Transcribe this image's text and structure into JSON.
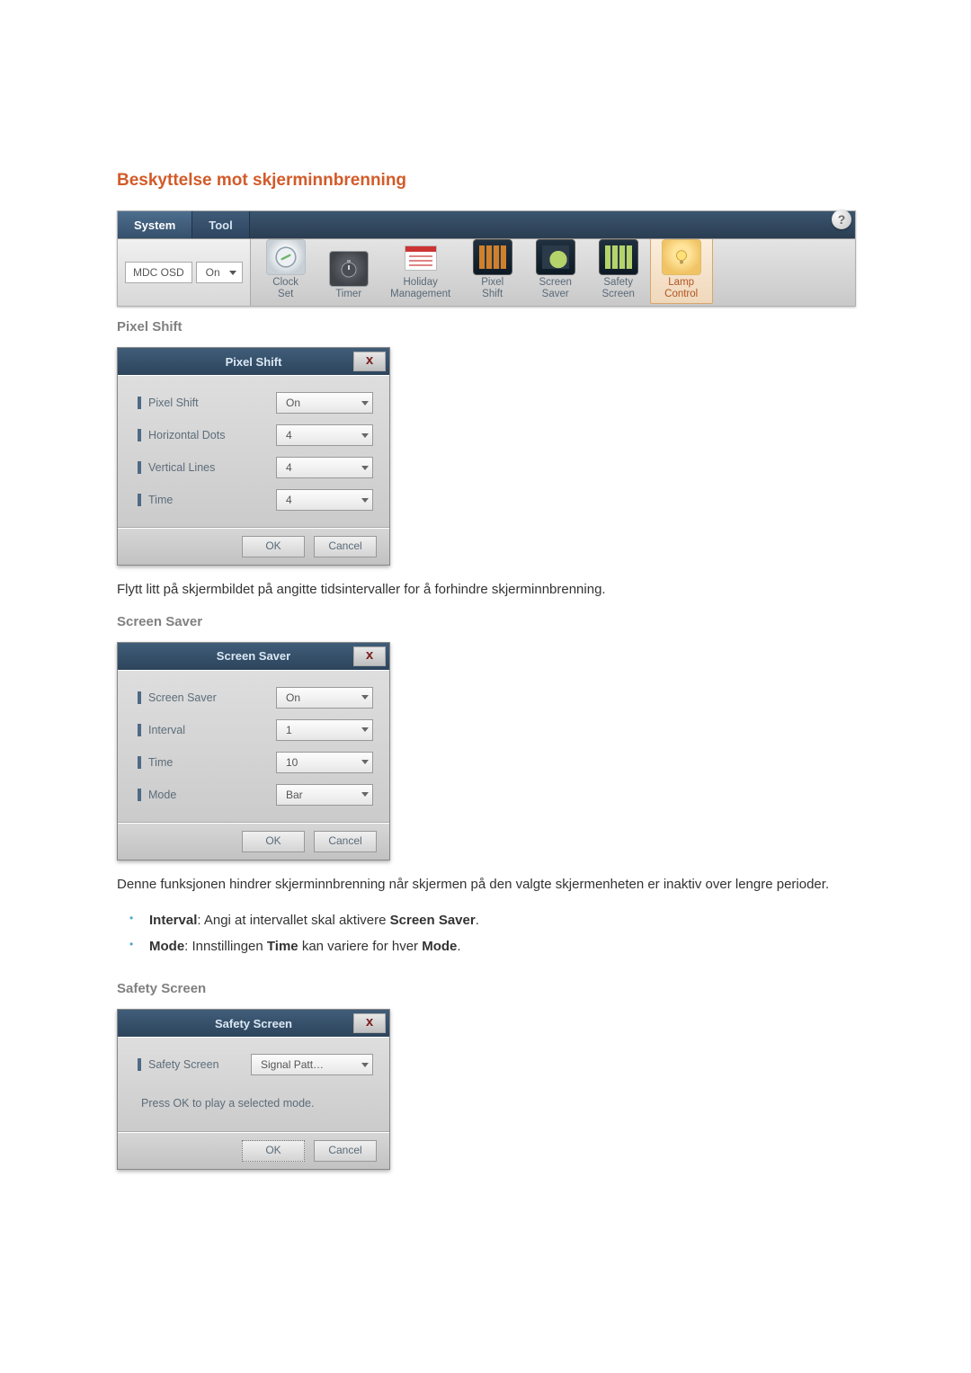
{
  "section_title": "Beskyttelse mot skjerminnbrenning",
  "toolbar": {
    "tabs": {
      "system": "System",
      "tool": "Tool"
    },
    "help": "?",
    "mdc_label": "MDC OSD",
    "mdc_value": "On",
    "buttons": {
      "clock_set": "Clock\nSet",
      "timer": "Timer",
      "holiday": "Holiday\nManagement",
      "pixel_shift": "Pixel\nShift",
      "screen_saver": "Screen\nSaver",
      "safety_screen": "Safety\nScreen",
      "lamp_control": "Lamp\nControl"
    }
  },
  "pixel_shift": {
    "heading": "Pixel Shift",
    "title": "Pixel Shift",
    "close": "x",
    "rows": {
      "pixel_shift": {
        "label": "Pixel Shift",
        "value": "On"
      },
      "horizontal": {
        "label": "Horizontal Dots",
        "value": "4"
      },
      "vertical": {
        "label": "Vertical Lines",
        "value": "4"
      },
      "time": {
        "label": "Time",
        "value": "4"
      }
    },
    "ok": "OK",
    "cancel": "Cancel",
    "desc": "Flytt litt på skjermbildet på angitte tidsintervaller for å forhindre skjerminnbrenning."
  },
  "screen_saver": {
    "heading": "Screen Saver",
    "title": "Screen Saver",
    "close": "x",
    "rows": {
      "screen_saver": {
        "label": "Screen Saver",
        "value": "On"
      },
      "interval": {
        "label": "Interval",
        "value": "1"
      },
      "time": {
        "label": "Time",
        "value": "10"
      },
      "mode": {
        "label": "Mode",
        "value": "Bar"
      }
    },
    "ok": "OK",
    "cancel": "Cancel",
    "desc": "Denne funksjonen hindrer skjerminnbrenning når skjermen på den valgte skjermenheten er inaktiv over lengre perioder.",
    "bullets": {
      "interval_prefix": "Interval",
      "interval_rest": ": Angi at intervallet skal aktivere ",
      "interval_bold2": "Screen Saver",
      "interval_tail": ".",
      "mode_prefix": "Mode",
      "mode_rest": ": Innstillingen ",
      "mode_bold2": "Time",
      "mode_mid": " kan variere for hver ",
      "mode_bold3": "Mode",
      "mode_tail": "."
    }
  },
  "safety_screen": {
    "heading": "Safety Screen",
    "title": "Safety Screen",
    "close": "x",
    "rows": {
      "safety_screen": {
        "label": "Safety Screen",
        "value": "Signal Patt…"
      }
    },
    "mode_text": "Press OK to play a selected mode.",
    "ok": "OK",
    "cancel": "Cancel"
  }
}
